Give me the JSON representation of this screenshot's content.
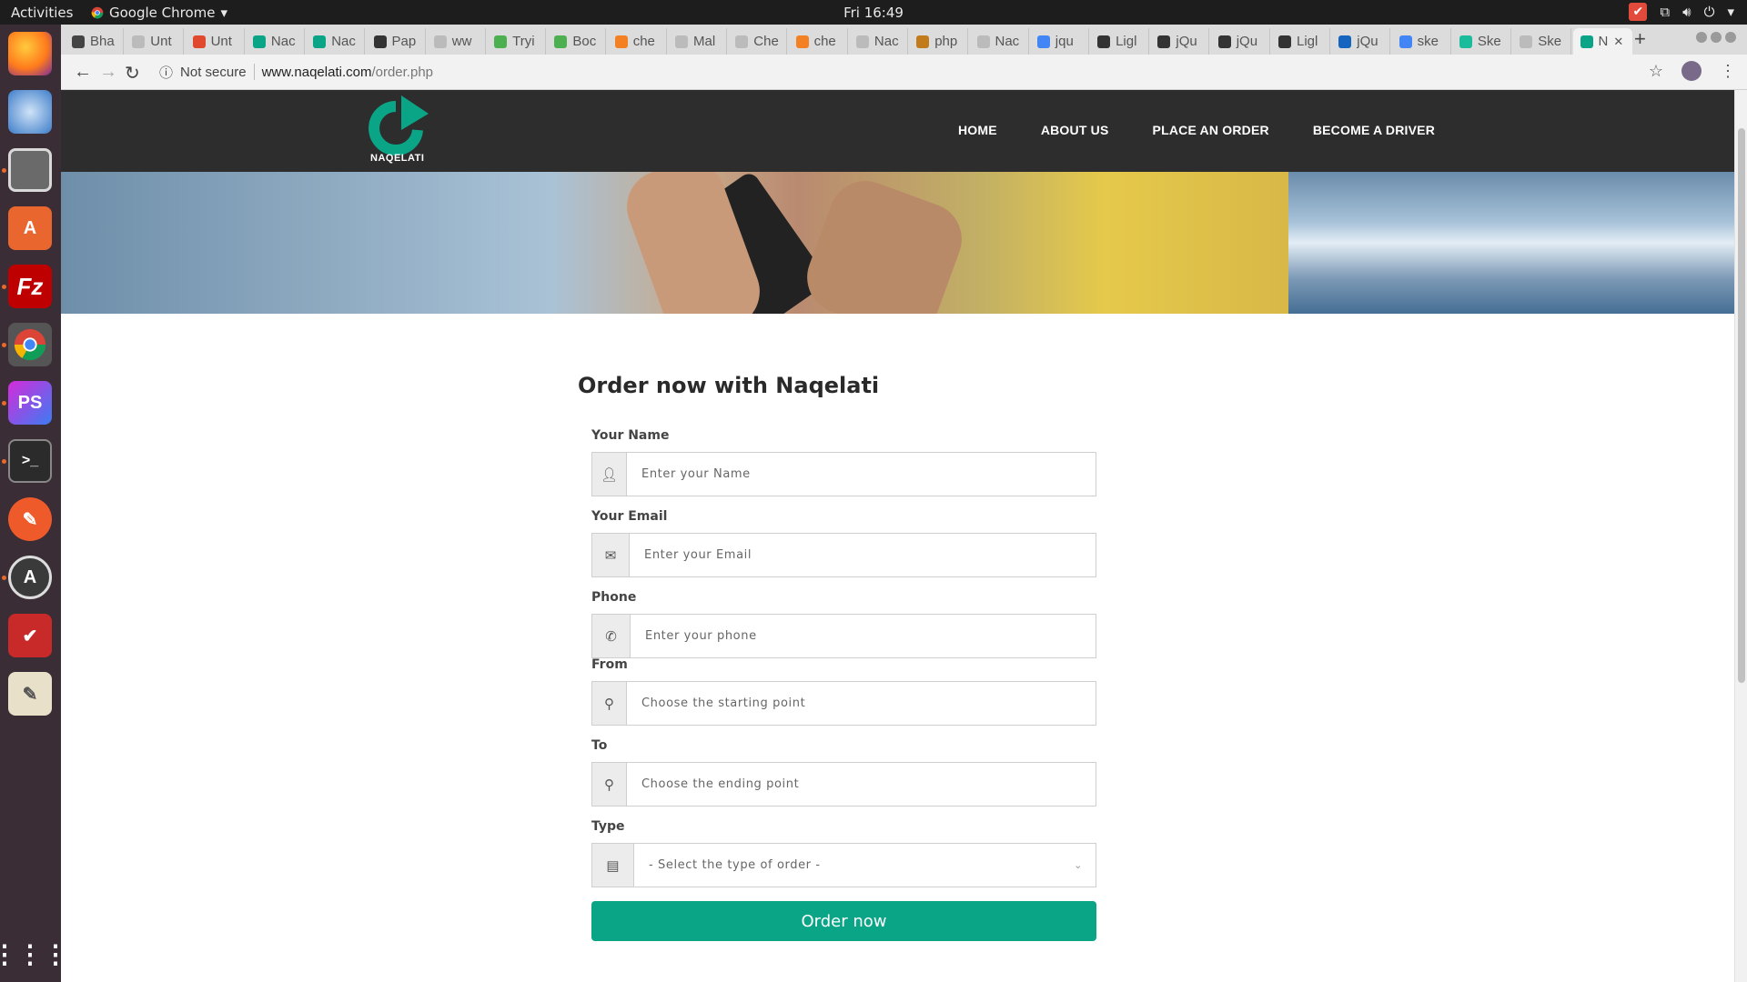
{
  "topbar": {
    "activities": "Activities",
    "app_name": "Google Chrome",
    "clock": "Fri 16:49"
  },
  "tabs": [
    {
      "label": "Bha",
      "icon": "hash-icon",
      "color": "#444444"
    },
    {
      "label": "Unt",
      "icon": "blank-doc-icon",
      "color": "#bbbbbb"
    },
    {
      "label": "Unt",
      "icon": "grid-icon",
      "color": "#e0492e"
    },
    {
      "label": "Nac",
      "icon": "naqelati-icon",
      "color": "#0aa586"
    },
    {
      "label": "Nac",
      "icon": "naqelati-icon",
      "color": "#0aa586"
    },
    {
      "label": "Pap",
      "icon": "bowtie-icon",
      "color": "#333333"
    },
    {
      "label": "ww",
      "icon": "blank-doc-icon",
      "color": "#bbbbbb"
    },
    {
      "label": "Tryi",
      "icon": "w3-icon",
      "color": "#4caf50"
    },
    {
      "label": "Boc",
      "icon": "w3-icon",
      "color": "#4caf50"
    },
    {
      "label": "che",
      "icon": "stackoverflow-icon",
      "color": "#f48024"
    },
    {
      "label": "Mal",
      "icon": "blank-doc-icon",
      "color": "#bbbbbb"
    },
    {
      "label": "Che",
      "icon": "blank-doc-icon",
      "color": "#bbbbbb"
    },
    {
      "label": "che",
      "icon": "stackoverflow-icon",
      "color": "#f48024"
    },
    {
      "label": "Nac",
      "icon": "blank-doc-icon",
      "color": "#bbbbbb"
    },
    {
      "label": "php",
      "icon": "php-icon",
      "color": "#c17b1b"
    },
    {
      "label": "Nac",
      "icon": "blank-doc-icon",
      "color": "#bbbbbb"
    },
    {
      "label": "jqu",
      "icon": "google-icon",
      "color": "#4285f4"
    },
    {
      "label": "Ligl",
      "icon": "light-icon",
      "color": "#333333"
    },
    {
      "label": "jQu",
      "icon": "jquery-icon",
      "color": "#333333"
    },
    {
      "label": "jQu",
      "icon": "jquery-icon",
      "color": "#333333"
    },
    {
      "label": "Ligl",
      "icon": "jquery-icon",
      "color": "#333333"
    },
    {
      "label": "jQu",
      "icon": "jq-icon",
      "color": "#1565c0"
    },
    {
      "label": "ske",
      "icon": "google-icon",
      "color": "#4285f4"
    },
    {
      "label": "Ske",
      "icon": "circle-icon",
      "color": "#1abc9c"
    },
    {
      "label": "Ske",
      "icon": "blank-doc-icon",
      "color": "#bbbbbb"
    },
    {
      "label": "N",
      "icon": "naqelati-icon",
      "color": "#0aa586",
      "active": true
    }
  ],
  "toolbar": {
    "security": "Not secure",
    "url_host": "www.naqelati.com",
    "url_path": "/order.php"
  },
  "site": {
    "logo_text": "NAQELATI",
    "nav": [
      "HOME",
      "ABOUT US",
      "PLACE AN ORDER",
      "BECOME A DRIVER"
    ]
  },
  "form": {
    "title": "Order now with Naqelati",
    "name_label": "Your Name",
    "name_placeholder": "Enter your Name",
    "email_label": "Your Email",
    "email_placeholder": "Enter your Email",
    "phone_label": "Phone",
    "phone_placeholder": "Enter your phone",
    "from_label": "From",
    "from_placeholder": "Choose the starting point",
    "to_label": "To",
    "to_placeholder": "Choose the ending point",
    "type_label": "Type",
    "type_selected": "- Select the type of order -",
    "submit_label": "Order now"
  },
  "colors": {
    "brand": "#0aa586",
    "header_bg": "#2d2d2d"
  }
}
